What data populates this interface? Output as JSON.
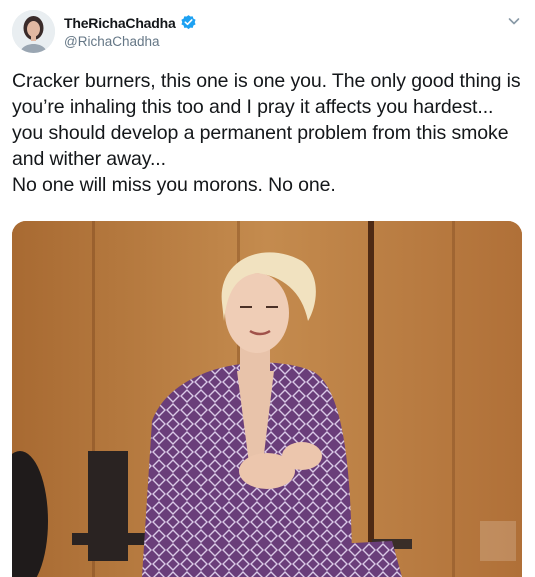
{
  "tweet": {
    "display_name": "TheRichaChadha",
    "handle": "@RichaChadha",
    "verified_icon": "verified-badge-icon",
    "menu_icon": "chevron-down-icon",
    "text": "Cracker burners, this one is one you. The only good thing is you’re inhaling this too and I pray it affects you hardest... you should develop a permanent problem from this smoke and wither away...\nNo one will miss you morons. No one.",
    "media_type": "gif",
    "colors": {
      "text": "#14171a",
      "secondary": "#657786",
      "verified": "#1da1f2"
    }
  }
}
